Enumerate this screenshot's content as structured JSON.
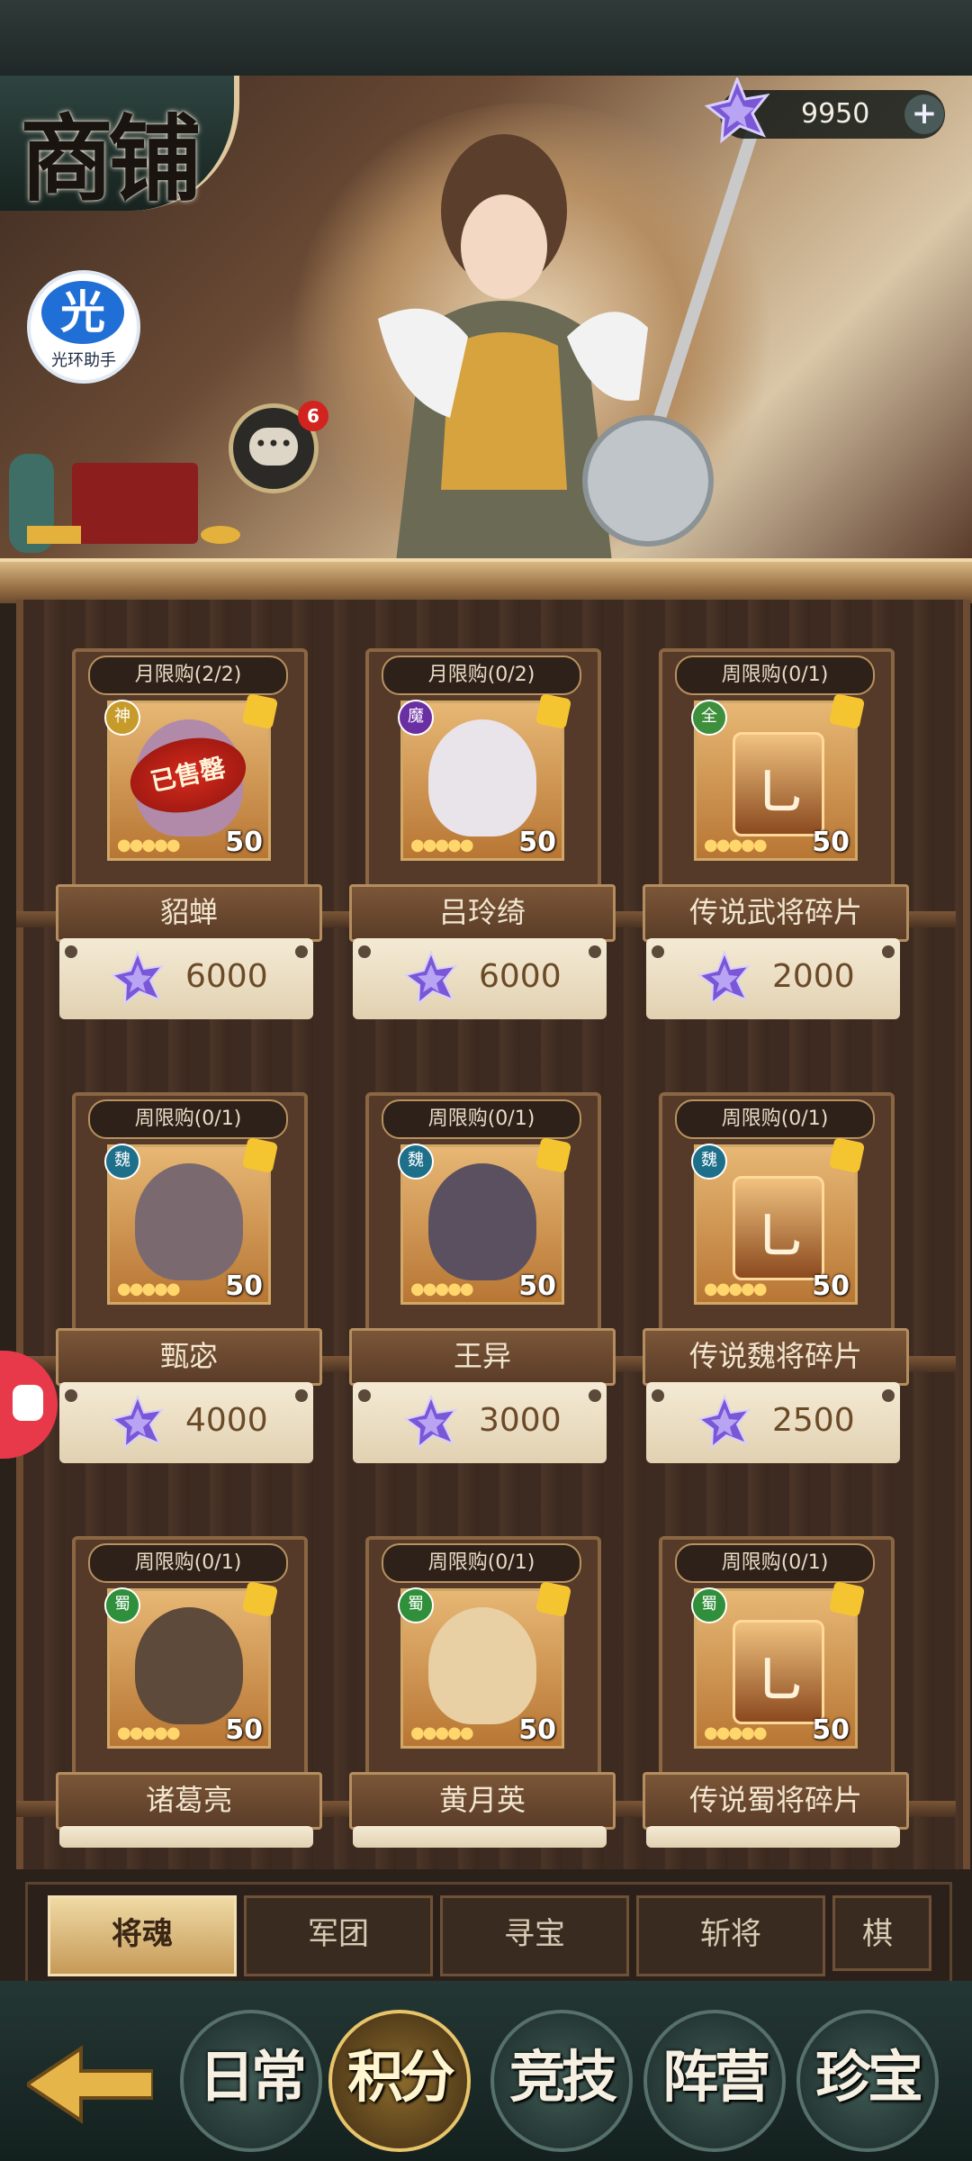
{
  "header": {
    "title": "商铺",
    "helper_icon_text": "光",
    "helper_label": "光环助手",
    "chat_badge": "6",
    "currency": {
      "icon": "purple-gem-icon",
      "value": "9950"
    }
  },
  "colors": {
    "gem": "#7a57d6",
    "accent": "#d9b783",
    "sold": "#c82418"
  },
  "shop": {
    "items": [
      {
        "limit": "月限购(2/2)",
        "faction": "神",
        "faction_color": "#c79b2a",
        "name": "貂蝉",
        "price": "6000",
        "count": "50",
        "sold_out": "已售罄",
        "type": "hero",
        "face": "#b08aa8"
      },
      {
        "limit": "月限购(0/2)",
        "faction": "魔",
        "faction_color": "#6a2fa3",
        "name": "吕玲绮",
        "price": "6000",
        "count": "50",
        "type": "hero",
        "face": "#e9e3ea"
      },
      {
        "limit": "周限购(0/1)",
        "faction": "全",
        "faction_color": "#3d8f3c",
        "name": "传说武将碎片",
        "price": "2000",
        "count": "50",
        "type": "emblem",
        "emblem": "乚"
      },
      {
        "limit": "周限购(0/1)",
        "faction": "魏",
        "faction_color": "#1e6f8a",
        "name": "甄宓",
        "price": "4000",
        "count": "50",
        "type": "hero",
        "face": "#7a6a70"
      },
      {
        "limit": "周限购(0/1)",
        "faction": "魏",
        "faction_color": "#1e6f8a",
        "name": "王异",
        "price": "3000",
        "count": "50",
        "type": "hero",
        "face": "#5b5060"
      },
      {
        "limit": "周限购(0/1)",
        "faction": "魏",
        "faction_color": "#1e6f8a",
        "name": "传说魏将碎片",
        "price": "2500",
        "count": "50",
        "type": "emblem",
        "emblem": "乚"
      },
      {
        "limit": "周限购(0/1)",
        "faction": "蜀",
        "faction_color": "#2f8f3a",
        "name": "诸葛亮",
        "price": "",
        "count": "50",
        "type": "hero",
        "face": "#5d4a3a"
      },
      {
        "limit": "周限购(0/1)",
        "faction": "蜀",
        "faction_color": "#2f8f3a",
        "name": "黄月英",
        "price": "",
        "count": "50",
        "type": "hero",
        "face": "#e8cfa4"
      },
      {
        "limit": "周限购(0/1)",
        "faction": "蜀",
        "faction_color": "#2f8f3a",
        "name": "传说蜀将碎片",
        "price": "",
        "count": "50",
        "type": "emblem",
        "emblem": "乚"
      }
    ]
  },
  "tabs": [
    "将魂",
    "军团",
    "寻宝",
    "斩将",
    "棋"
  ],
  "nav": [
    "日常",
    "积分",
    "竞技",
    "阵营",
    "珍宝"
  ]
}
